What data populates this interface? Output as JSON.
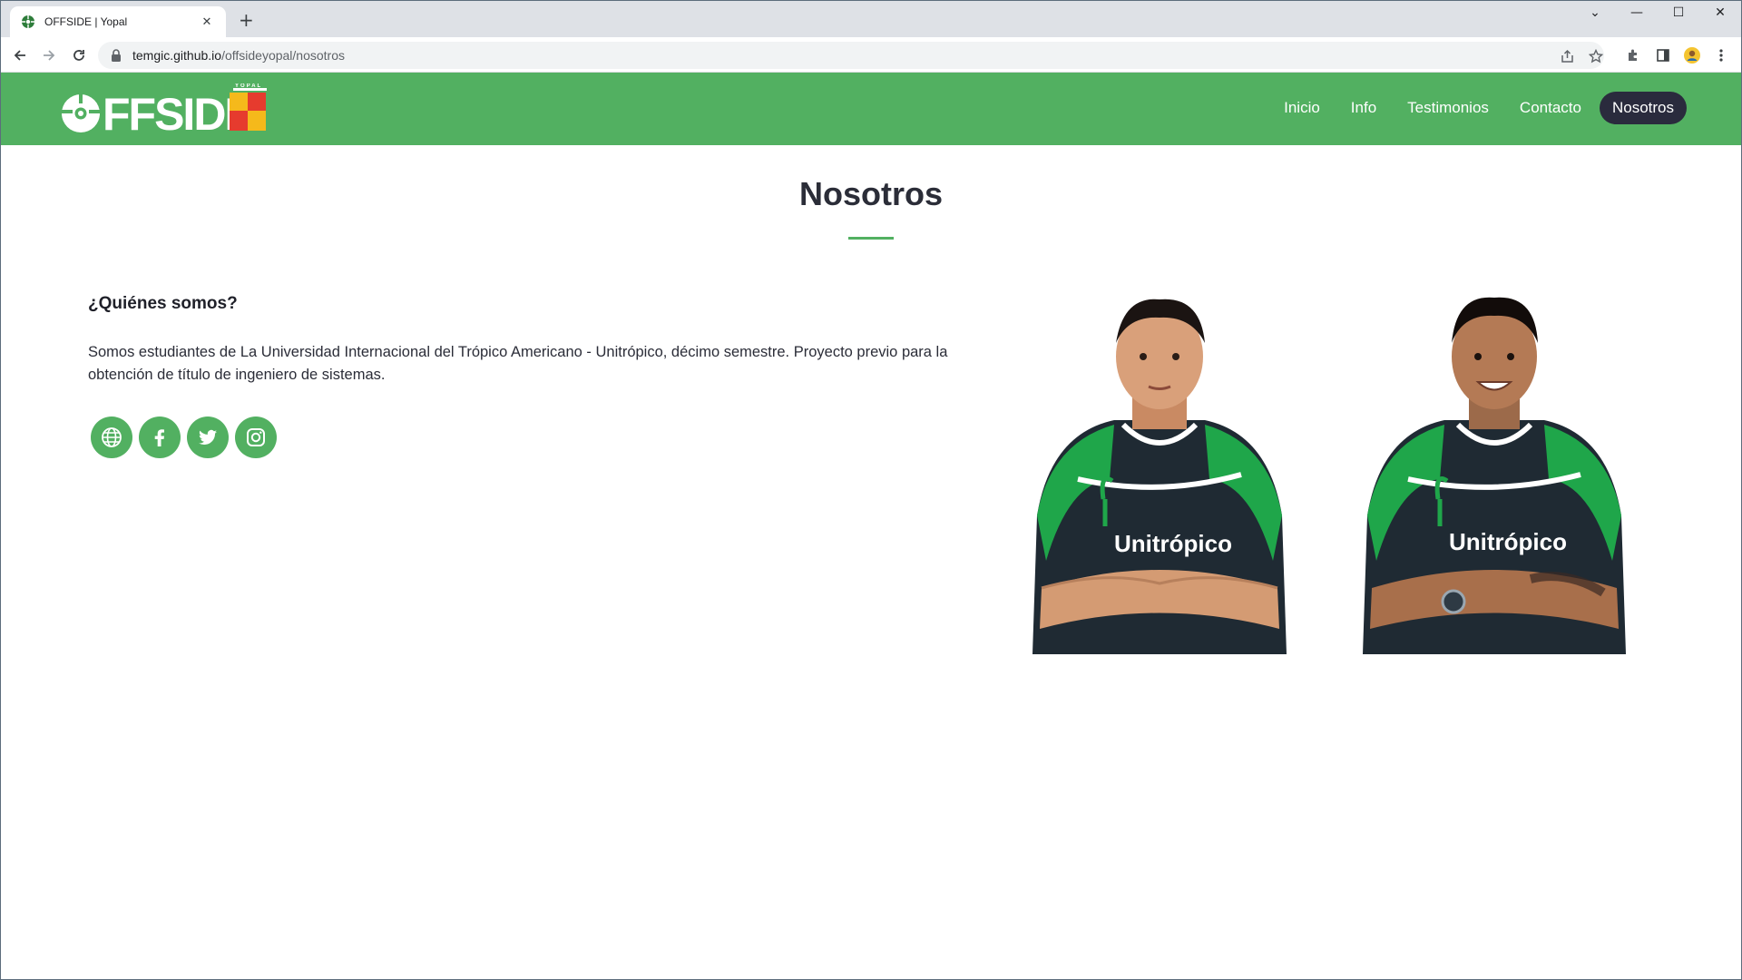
{
  "browser": {
    "tab_title": "OFFSIDE | Yopal",
    "tab_close": "✕",
    "new_tab": "+",
    "url_domain": "temgic.github.io",
    "url_path": "/offsideyopal/nosotros",
    "window_controls": {
      "dropdown": "⌄",
      "minimize": "—",
      "maximize": "☐",
      "close": "✕"
    }
  },
  "site": {
    "logo_text": "FFSIDE",
    "logo_subtext": "YOPAL",
    "nav": [
      {
        "label": "Inicio",
        "active": false
      },
      {
        "label": "Info",
        "active": false
      },
      {
        "label": "Testimonios",
        "active": false
      },
      {
        "label": "Contacto",
        "active": false
      },
      {
        "label": "Nosotros",
        "active": true
      }
    ]
  },
  "section": {
    "title": "Nosotros",
    "heading": "¿Quiénes somos?",
    "text": "Somos estudiantes de La Universidad Internacional del Trópico Americano - Unitrópico, décimo semestre. Proyecto previo para la obtención de título de ingeniero de sistemas.",
    "socials": [
      "globe-icon",
      "facebook-icon",
      "twitter-icon",
      "instagram-icon"
    ],
    "members": [
      {
        "jersey_text": "Unitrópico"
      },
      {
        "jersey_text": "Unitrópico"
      }
    ]
  },
  "colors": {
    "brand_green": "#52b061",
    "dark": "#2a2b3d",
    "logo_red": "#e63b2e",
    "logo_yellow": "#f5b91b"
  }
}
